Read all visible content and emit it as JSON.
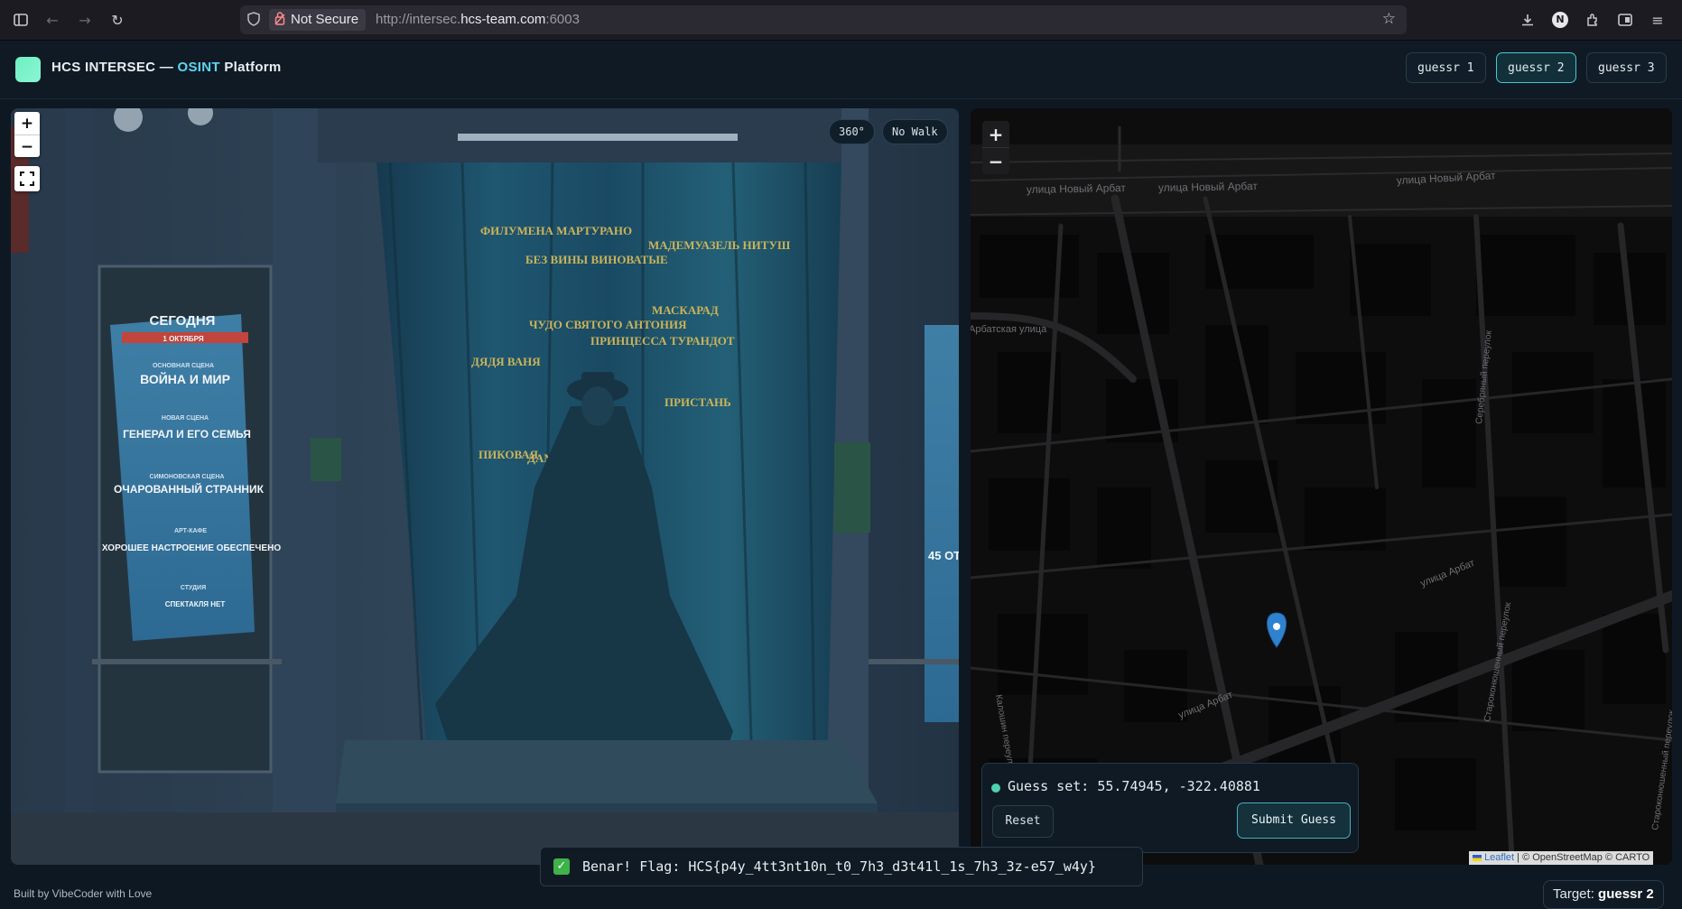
{
  "browser": {
    "security_label": "Not Secure",
    "url_prefix": "http://intersec.",
    "url_domain": "hcs-team.com",
    "url_suffix": ":6003",
    "profile_initial": "N"
  },
  "app": {
    "title_prefix": "HCS INTERSEC — ",
    "title_osint": "OSINT",
    "title_suffix": " Platform",
    "accent": "#5cd6f2"
  },
  "tabs": [
    {
      "label": "guessr 1",
      "active": false
    },
    {
      "label": "guessr 2",
      "active": true
    },
    {
      "label": "guessr 3",
      "active": false
    }
  ],
  "panorama": {
    "zoom_in": "+",
    "zoom_out": "−",
    "mode_label": "360°",
    "walk_label": "No Walk",
    "billboard": {
      "header": "СЕГОДНЯ",
      "date": "1 ОКТЯБРЯ",
      "items": [
        "ОСНОВНАЯ СЦЕНА",
        "ВОЙНА И МИР",
        "НОВАЯ СЦЕНА",
        "ГЕНЕРАЛ И ЕГО СЕМЬЯ",
        "СИМОНОВСКАЯ СЦЕНА",
        "ОЧАРОВАННЫЙ СТРАННИК",
        "АРТ-КАФЕ",
        "ХОРОШЕЕ НАСТРОЕНИЕ ОБЕСПЕЧЕНО",
        "СТУДИЯ",
        "СПЕКТАКЛЯ НЕТ"
      ]
    },
    "curtain_words": [
      "ФИЛУМЕНА МАРТУРАНО",
      "БЕЗ ВИНЫ ВИНОВАТЫЕ",
      "МАДЕМУАЗЕЛЬ НИТУШ",
      "МАСКАРАД",
      "ЧУДО СВЯТОГО АНТОНИЯ",
      "ПРИНЦЕССА ТУРАНДОТ",
      "ДЯДЯ ВАНЯ",
      "ПРИСТАНЬ",
      "ПИКОВАЯ",
      "ДАМА"
    ],
    "right_board_text": "45 ОТ"
  },
  "map": {
    "zoom_in": "+",
    "zoom_out": "−",
    "street_labels": [
      "улица Новый Арбат",
      "улица Новый Арбат",
      "улица Новый Арбат",
      "Арбатская улица",
      "улица Арбат",
      "улица Арбат",
      "Староконюшенный переулок",
      "Серебряный переулок",
      "Староконюшенный переулок",
      "Калошин переулок"
    ],
    "attribution_leaflet": "Leaflet",
    "attribution_rest": " | © OpenStreetMap © CARTO"
  },
  "guess": {
    "status": "Guess set: 55.74945, -322.40881",
    "reset_label": "Reset",
    "submit_label": "Submit Guess"
  },
  "toast": {
    "message": "Benar! Flag: HCS{p4y_4tt3nt10n_t0_7h3_d3t41l_1s_7h3_3z-e57_w4y}"
  },
  "footer": {
    "credit": "Built by VibeCoder with Love",
    "target_label": "Target: ",
    "target_value": "guessr 2"
  }
}
